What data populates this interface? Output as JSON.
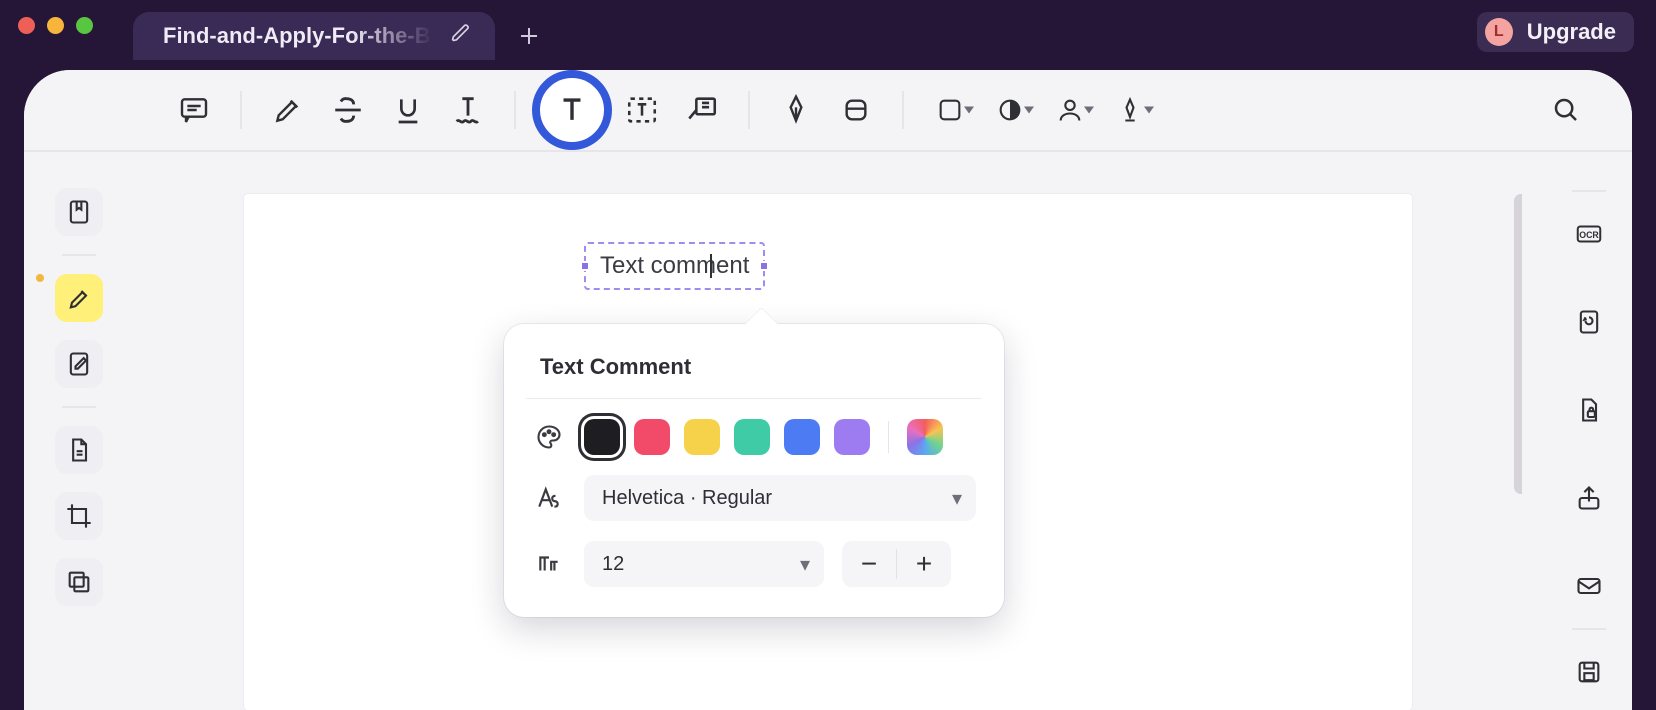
{
  "titlebar": {
    "tab_label": "Find-and-Apply-For-the-Be",
    "avatar_letter": "L",
    "upgrade_label": "Upgrade"
  },
  "toolbar": {
    "items": [
      "comment-bubble",
      "highlighter",
      "strikethrough",
      "underline",
      "squiggly",
      "text-comment",
      "text-box",
      "callout",
      "pen",
      "eraser",
      "shape-color",
      "ink-color",
      "person",
      "sign"
    ]
  },
  "sidebar_left": {
    "items": [
      "bookmarks",
      "highlight",
      "edit",
      "file",
      "crop",
      "layers"
    ],
    "active": "highlight"
  },
  "sidebar_right": {
    "items": [
      "search",
      "ocr",
      "refresh",
      "lock",
      "share",
      "mail",
      "save"
    ]
  },
  "document": {
    "text_comment_value": "Text comment"
  },
  "popover": {
    "title": "Text Comment",
    "colors": [
      "#1E1E22",
      "#F24B6A",
      "#F5D249",
      "#3FCBA6",
      "#4D7BF3",
      "#9D7BF0"
    ],
    "selected_color_index": 0,
    "font_select_label": "Helvetica · Regular",
    "font_size_value": "12"
  }
}
